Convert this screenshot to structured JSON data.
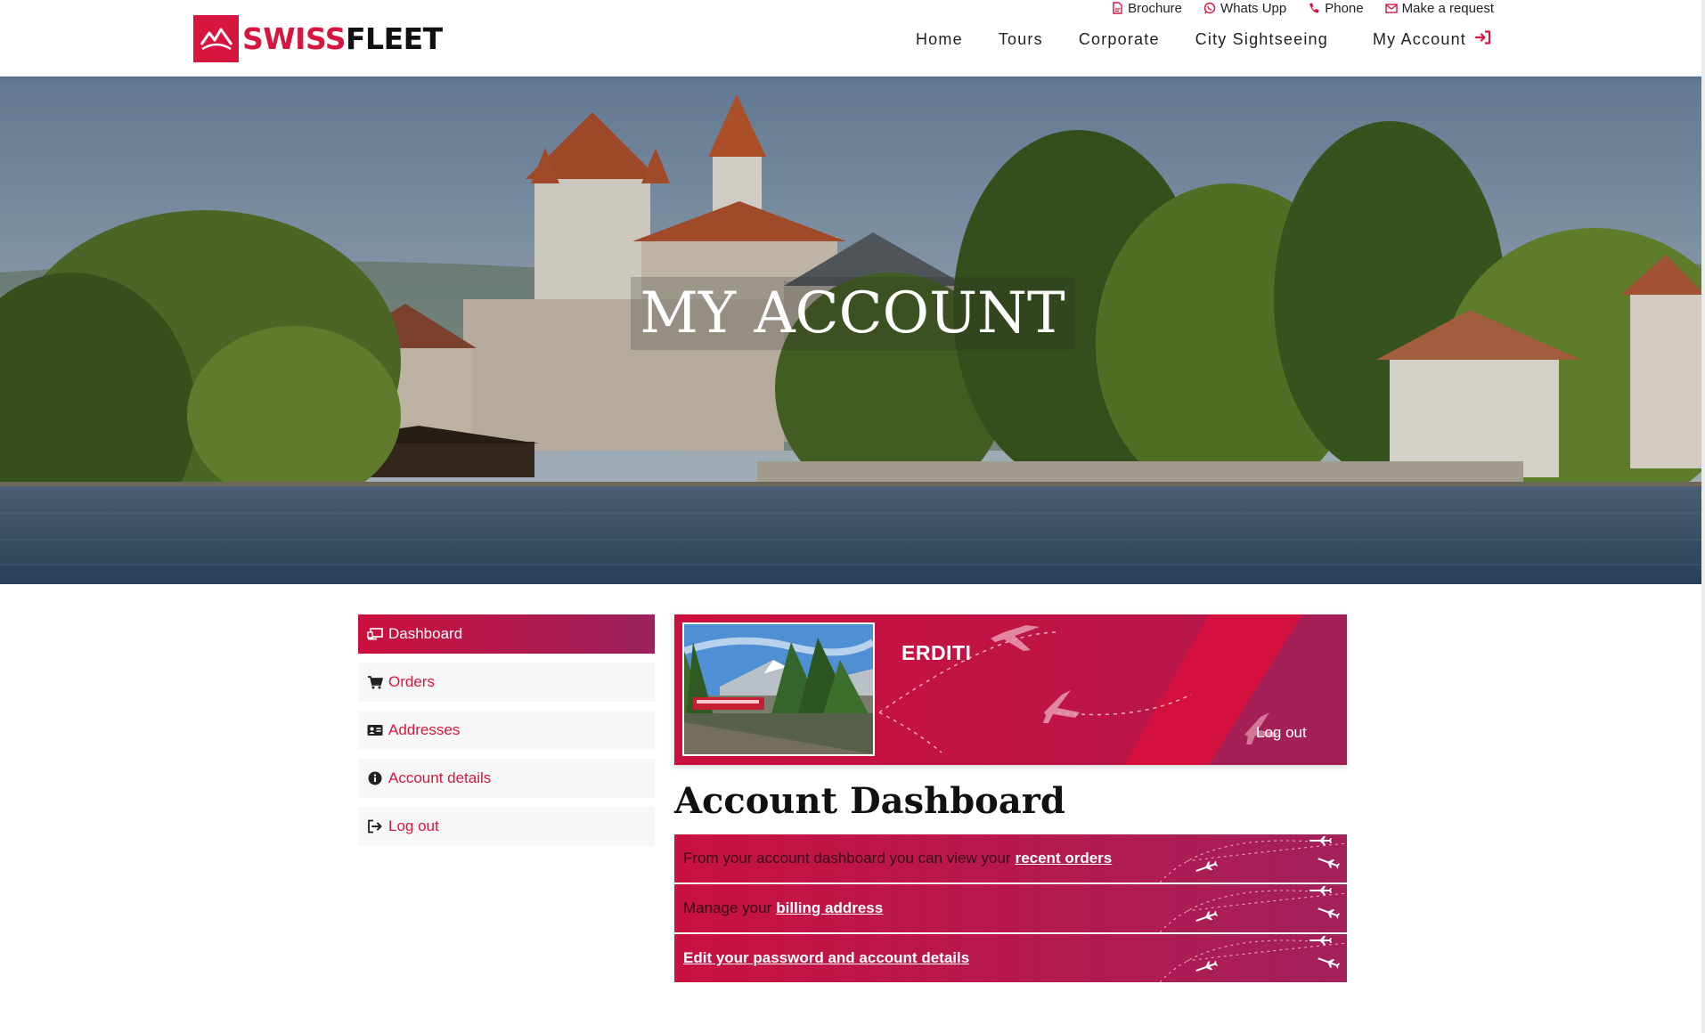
{
  "brand": {
    "name_part1": "SWISS",
    "name_part2": "FLEET",
    "color": "#d6163f"
  },
  "topbar": [
    {
      "label": "Brochure",
      "icon": "file-pdf-icon"
    },
    {
      "label": "Whats Upp",
      "icon": "whatsapp-icon"
    },
    {
      "label": "Phone",
      "icon": "phone-icon"
    },
    {
      "label": "Make a request",
      "icon": "envelope-icon"
    }
  ],
  "nav": {
    "items": [
      "Home",
      "Tours",
      "Corporate",
      "City Sightseeing"
    ],
    "account_label": "My Account",
    "account_icon": "sign-in-icon"
  },
  "hero": {
    "title": "MY ACCOUNT"
  },
  "sidebar": [
    {
      "label": "Dashboard",
      "icon": "laptop-icon",
      "active": true
    },
    {
      "label": "Orders",
      "icon": "cart-icon",
      "active": false
    },
    {
      "label": "Addresses",
      "icon": "address-card-icon",
      "active": false
    },
    {
      "label": "Account details",
      "icon": "info-circle-icon",
      "active": false
    },
    {
      "label": "Log out",
      "icon": "sign-out-icon",
      "active": false
    }
  ],
  "profile": {
    "name": "ERDITI",
    "logout_label": "Log out"
  },
  "dashboard": {
    "title": "Account Dashboard",
    "rows": [
      {
        "text": "From your account dashboard you can view your",
        "link": "recent orders"
      },
      {
        "text": "Manage your",
        "link": "billing address"
      },
      {
        "text": "",
        "link": "Edit your password and account details"
      }
    ]
  },
  "colors": {
    "accent": "#d6163f",
    "accent_dark": "#9b235c",
    "panel": "#f7f7f7"
  }
}
